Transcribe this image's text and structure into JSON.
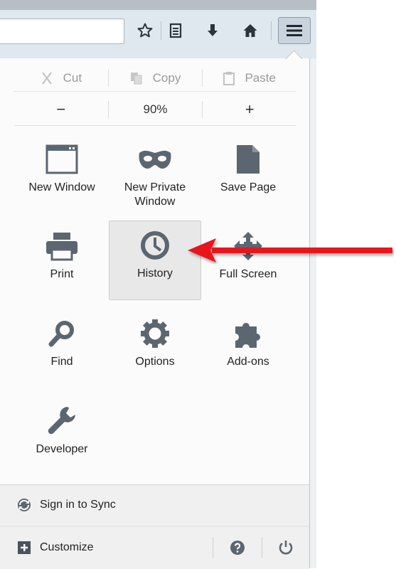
{
  "menu": {
    "cut_label": "Cut",
    "copy_label": "Copy",
    "paste_label": "Paste",
    "zoom_out_label": "−",
    "zoom_level": "90%",
    "zoom_in_label": "+",
    "items": [
      {
        "label": "New Window",
        "icon": "window-icon"
      },
      {
        "label": "New Private Window",
        "icon": "mask-icon"
      },
      {
        "label": "Save Page",
        "icon": "page-icon"
      },
      {
        "label": "Print",
        "icon": "printer-icon"
      },
      {
        "label": "History",
        "icon": "clock-icon"
      },
      {
        "label": "Full Screen",
        "icon": "fullscreen-icon"
      },
      {
        "label": "Find",
        "icon": "magnifier-icon"
      },
      {
        "label": "Options",
        "icon": "gear-icon"
      },
      {
        "label": "Add-ons",
        "icon": "puzzle-icon"
      },
      {
        "label": "Developer",
        "icon": "wrench-icon"
      }
    ],
    "sync_label": "Sign in to Sync",
    "customize_label": "Customize"
  },
  "colors": {
    "icon_gray": "#5c6670",
    "arrow_red": "#e8141c",
    "footer_bg": "#f0f0f0"
  }
}
